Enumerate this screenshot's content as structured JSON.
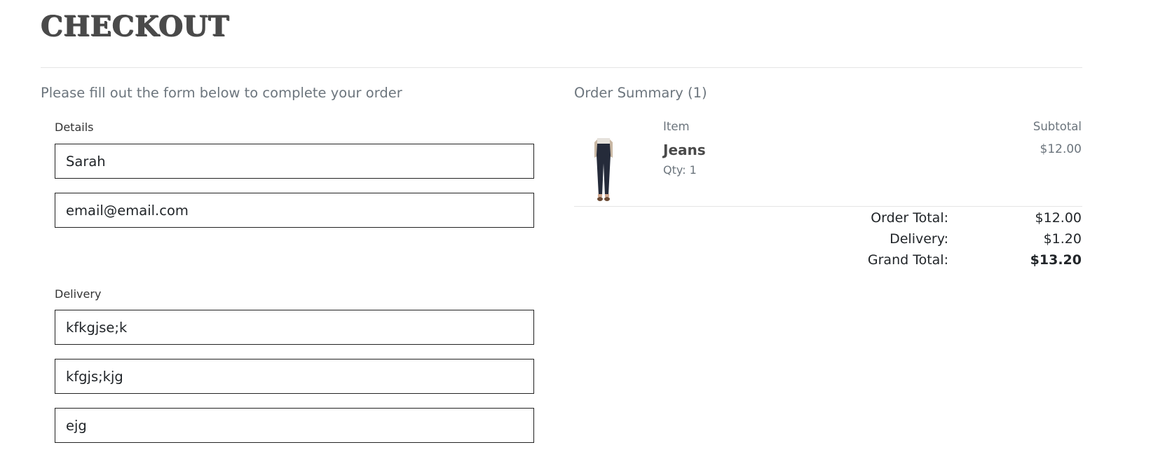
{
  "header": {
    "title": "CHECKOUT"
  },
  "form": {
    "intro": "Please fill out the form below to complete your order",
    "details": {
      "label": "Details",
      "name_value": "Sarah",
      "email_value": "email@email.com"
    },
    "delivery": {
      "label": "Delivery",
      "line1_value": "kfkgjse;k",
      "line2_value": "kfgjs;kjg",
      "line3_value": "ejg"
    }
  },
  "summary": {
    "title": "Order Summary (1)",
    "col_item": "Item",
    "col_subtotal": "Subtotal",
    "items": [
      {
        "name": "Jeans",
        "qty": "Qty: 1",
        "price": "$12.00",
        "image_icon": "jeans-product-image"
      }
    ],
    "totals": {
      "order_total_label": "Order Total:",
      "order_total_value": "$12.00",
      "delivery_label": "Delivery:",
      "delivery_value": "$1.20",
      "grand_total_label": "Grand Total:",
      "grand_total_value": "$13.20"
    }
  }
}
